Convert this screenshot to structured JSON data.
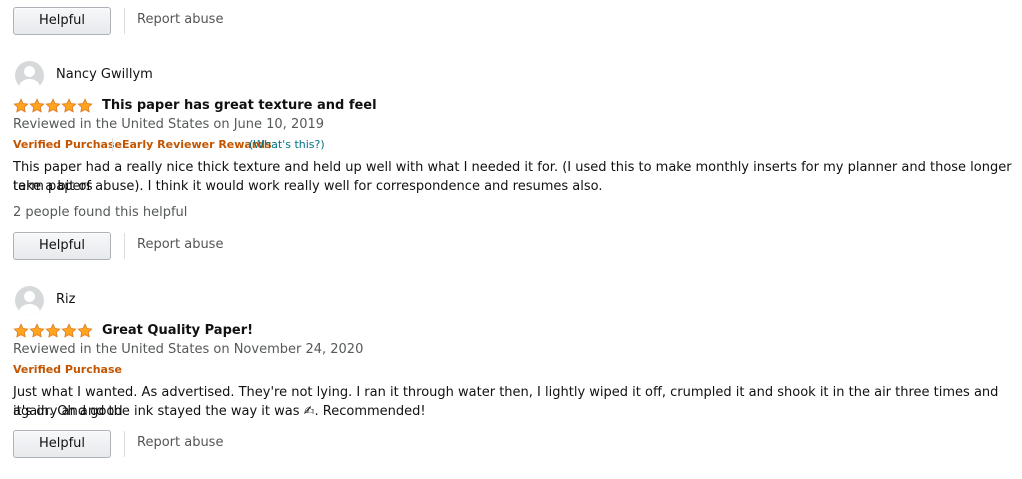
{
  "colors": {
    "star_fill": "#ffa41c",
    "star_stroke": "#de7921",
    "verified": "#c45500",
    "link": "#007185",
    "muted": "#565959"
  },
  "top_actions": {
    "helpful_label": "Helpful",
    "report_label": "Report abuse"
  },
  "reviews": [
    {
      "author": "Nancy Gwillym",
      "rating": 5,
      "title": "This paper has great texture and feel",
      "date": "Reviewed in the United States on June 10, 2019",
      "verified": "Verified Purchase",
      "badge": "Early Reviewer Rewards",
      "badge_link": "(What's this?)",
      "text_line1": "This paper had a really nice thick texture and held up well with what I needed it for. (I used this to make monthly inserts for my planner and those longer term papers",
      "text_line2": "take a bit of abuse). I think it would work really well for correspondence and resumes also.",
      "helpful_count": "2 people found this helpful",
      "helpful_label": "Helpful",
      "report_label": "Report abuse"
    },
    {
      "author": "Riz",
      "rating": 5,
      "title": "Great Quality Paper!",
      "date": "Reviewed in the United States on November 24, 2020",
      "verified": "Verified Purchase",
      "text_line1": "Just what I wanted. As advertised. They're not lying. I ran it through water then, I lightly wiped it off, crumpled it and shook it in the air three times and it's dry and good",
      "text_line2": "again. Oh and the ink stayed the way it was ✍. Recommended!",
      "helpful_label": "Helpful",
      "report_label": "Report abuse"
    }
  ]
}
